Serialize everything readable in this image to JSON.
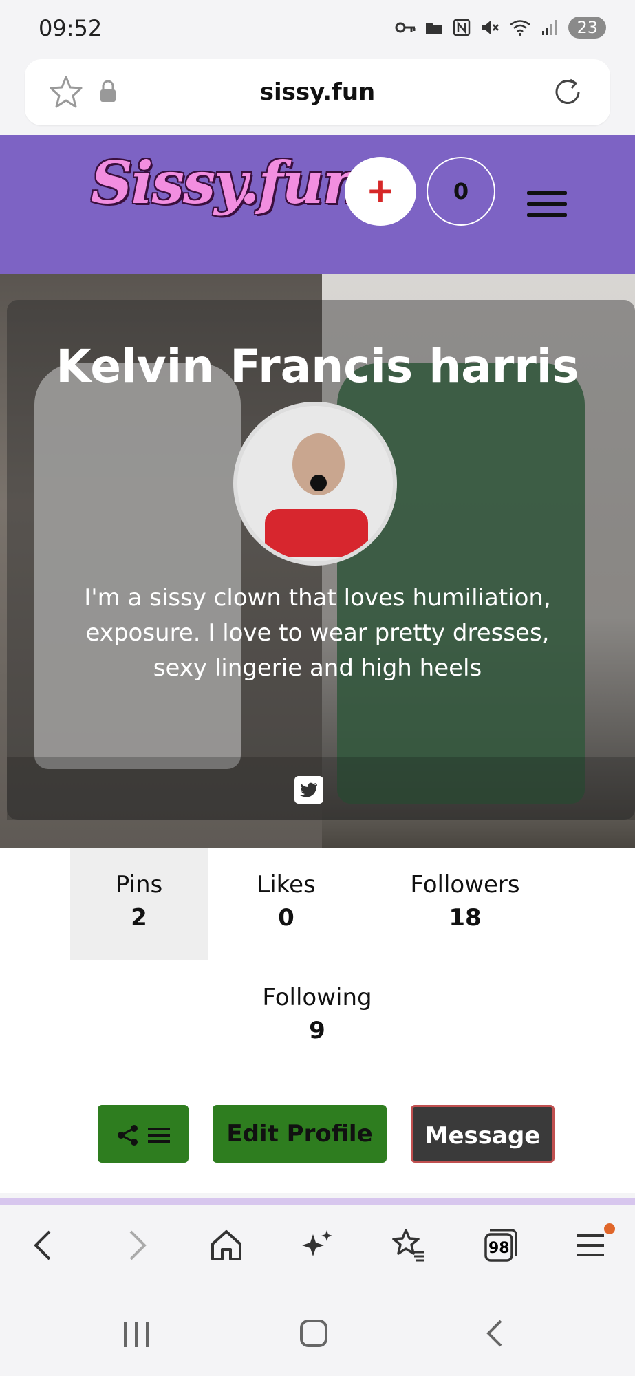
{
  "status_bar": {
    "time": "09:52",
    "battery": "23"
  },
  "browser": {
    "url": "sissy.fun",
    "tabs_count": "98"
  },
  "header": {
    "logo": "Sissy.fun",
    "add_label": "+",
    "notif_count": "0"
  },
  "profile": {
    "name": "Kelvin Francis harris",
    "bio": "I'm a sissy clown that loves humiliation, exposure. I love to wear pretty dresses, sexy lingerie and high heels"
  },
  "stats": {
    "pins_label": "Pins",
    "pins_value": "2",
    "likes_label": "Likes",
    "likes_value": "0",
    "followers_label": "Followers",
    "followers_value": "18",
    "following_label": "Following",
    "following_value": "9"
  },
  "actions": {
    "edit_label": "Edit Profile",
    "message_label": "Message"
  },
  "colors": {
    "header": "#7d63c4",
    "green_button": "#2e7d1f",
    "dark_button": "#3a3a3a",
    "accent_red": "#d62828"
  },
  "icons": [
    "key-icon",
    "folder-icon",
    "nfc-icon",
    "mute-icon",
    "wifi-icon",
    "signal-icon",
    "star-icon",
    "lock-icon",
    "reload-icon",
    "twitter-icon",
    "share-icon",
    "list-icon",
    "back-icon",
    "forward-icon",
    "home-icon",
    "sparkle-icon",
    "bookmarks-icon",
    "tabs-icon",
    "browser-menu-icon"
  ]
}
